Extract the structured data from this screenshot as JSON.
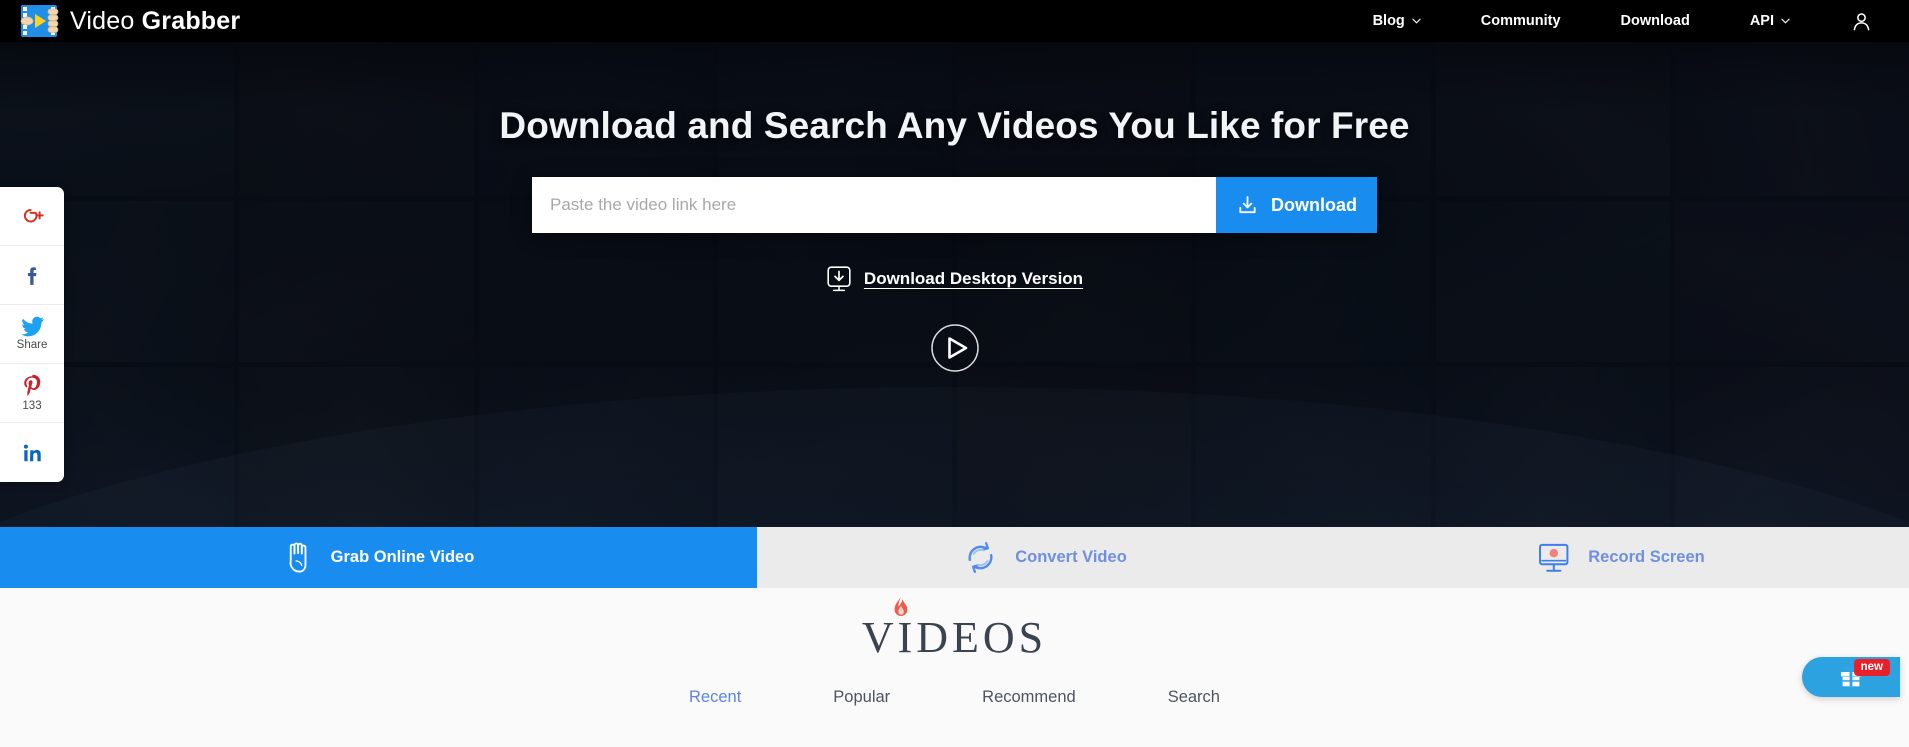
{
  "brand": {
    "name_light": "Video",
    "name_bold": "Grabber",
    "logo_icon": "film-strip-grab-icon"
  },
  "nav": {
    "items": [
      {
        "label": "Blog",
        "has_caret": true,
        "icon": "chevron-down-icon"
      },
      {
        "label": "Community",
        "has_caret": false,
        "icon": ""
      },
      {
        "label": "Download",
        "has_caret": false,
        "icon": ""
      },
      {
        "label": "API",
        "has_caret": true,
        "icon": "chevron-down-icon"
      }
    ],
    "account_icon": "user-account-icon"
  },
  "hero": {
    "title": "Download and Search Any Videos You Like for Free",
    "search": {
      "placeholder": "Paste the video link here",
      "value": "",
      "button_label": "Download",
      "button_icon": "download-tray-icon",
      "button_color": "#198cf0"
    },
    "desktop_link": {
      "label": "Download Desktop Version",
      "icon": "download-to-device-icon"
    },
    "play_button_icon": "play-circle-icon"
  },
  "social": {
    "items": [
      {
        "icon": "google-plus-icon",
        "glyph": "G+",
        "caption": "",
        "color": "#d93025"
      },
      {
        "icon": "facebook-icon",
        "glyph": "f",
        "caption": "",
        "color": "#3b5998"
      },
      {
        "icon": "twitter-icon",
        "glyph": "",
        "caption": "Share",
        "color": "#1da1f2"
      },
      {
        "icon": "pinterest-icon",
        "glyph": "",
        "caption": "133",
        "color": "#c8232c"
      },
      {
        "icon": "linkedin-icon",
        "glyph": "in",
        "caption": "",
        "color": "#0a66c2"
      }
    ]
  },
  "tabs": {
    "items": [
      {
        "label": "Grab Online Video",
        "icon": "grab-hand-icon",
        "active": true
      },
      {
        "label": "Convert Video",
        "icon": "convert-refresh-icon",
        "active": false
      },
      {
        "label": "Record Screen",
        "icon": "record-monitor-icon",
        "active": false
      }
    ],
    "active_color": "#198cf0",
    "inactive_bg": "#ebebeb",
    "inactive_text": "#6f8fe0"
  },
  "videos_section": {
    "logo_text": "VIDEOS",
    "logo_icon": "flame-icon",
    "subtabs": [
      {
        "label": "Recent",
        "active": true
      },
      {
        "label": "Popular",
        "active": false
      },
      {
        "label": "Recommend",
        "active": false
      },
      {
        "label": "Search",
        "active": false
      }
    ]
  },
  "gift_widget": {
    "icon": "gift-box-icon",
    "badge": "new",
    "badge_color": "#e8202a",
    "background": "#2ca2e0"
  },
  "collage": {
    "tiles": [
      "#1d2a33",
      "#2a2118",
      "#14202c",
      "#23303c",
      "#2a1c18",
      "#182430",
      "#2e2a26",
      "#201a26",
      "#1a2630",
      "#26211c",
      "#111c28",
      "#1e2a36",
      "#2c2a22",
      "#142232",
      "#1c2834",
      "#241c2a",
      "#18222c",
      "#2b2a24",
      "#1a2432",
      "#202c38",
      "#261e1a",
      "#16222e",
      "#1e2632",
      "#221c28"
    ]
  }
}
